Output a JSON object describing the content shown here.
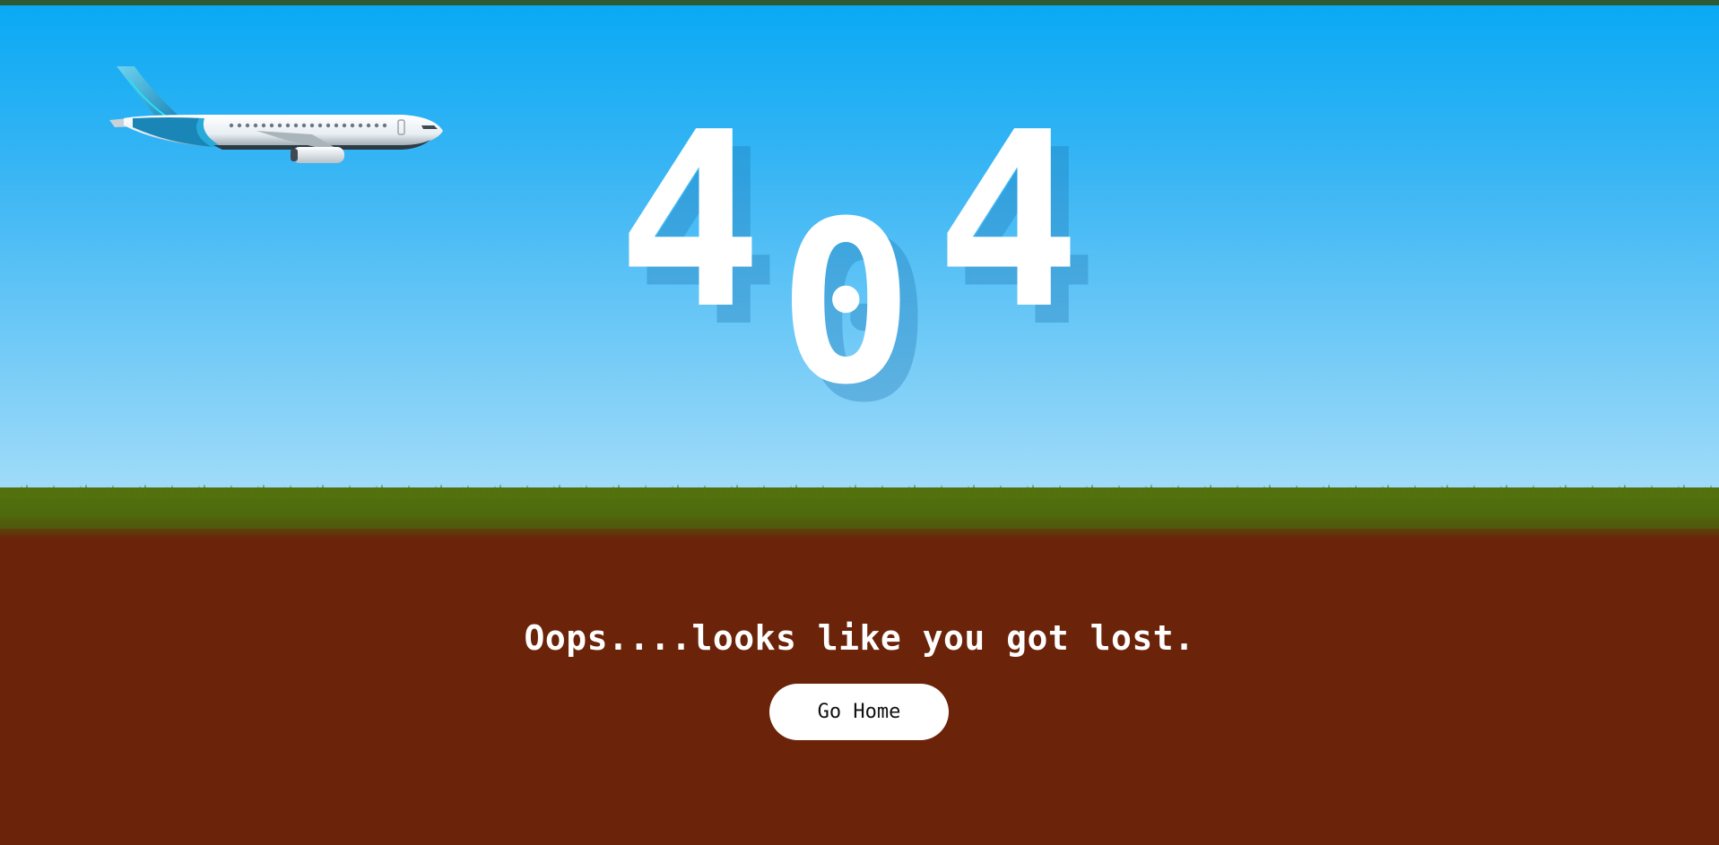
{
  "error": {
    "digits": [
      "4",
      "0",
      "4"
    ]
  },
  "message": "Oops....looks like you got lost.",
  "home_button": {
    "label": "Go Home"
  },
  "colors": {
    "sky_top": "#0aa9f4",
    "sky_bottom": "#a4ddf9",
    "grass": "#4e6a0c",
    "ground": "#6b2309",
    "top_bar": "#2b5a34",
    "text": "#ffffff",
    "button_bg": "#ffffff",
    "button_text": "#111111"
  },
  "icons": {
    "illustration": "airplane-icon"
  }
}
